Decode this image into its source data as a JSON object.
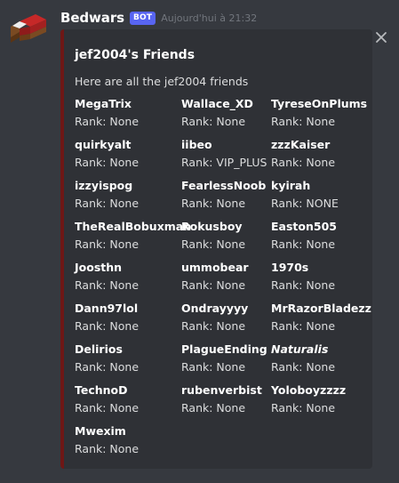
{
  "message": {
    "author": "Bedwars",
    "badge": "BOT",
    "timestamp": "Aujourd'hui à 21:32"
  },
  "colors": {
    "embed_border": "#6e1716",
    "badge_bg": "#5865f2",
    "background": "#36393f",
    "embed_bg": "#2f3136"
  },
  "icons": {
    "avatar": "bed-icon",
    "close": "close-icon"
  },
  "embed": {
    "title": "jef2004's Friends",
    "description": "Here are all the jef2004 friends",
    "fields": [
      {
        "name": "MegaTrix",
        "value": "Rank: None"
      },
      {
        "name": "Wallace_XD",
        "value": "Rank: None"
      },
      {
        "name": "TyreseOnPlums",
        "value": "Rank: None"
      },
      {
        "name": "quirkyalt",
        "value": "Rank: None"
      },
      {
        "name": "iibeo",
        "value": "Rank: VIP_PLUS"
      },
      {
        "name": "zzzKaiser",
        "value": "Rank: None"
      },
      {
        "name": "izzyispog",
        "value": "Rank: None"
      },
      {
        "name": "FearlessNoob",
        "value": "Rank: None"
      },
      {
        "name": "kyirah",
        "value": "Rank: NONE"
      },
      {
        "name": "TheRealBobuxman",
        "value": "Rank: None"
      },
      {
        "name": "Rokusboy",
        "value": "Rank: None"
      },
      {
        "name": "Easton505",
        "value": "Rank: None"
      },
      {
        "name": "Joosthn",
        "value": "Rank: None"
      },
      {
        "name": "ummobear",
        "value": "Rank: None"
      },
      {
        "name": "1970s",
        "value": "Rank: None"
      },
      {
        "name": "Dann97lol",
        "value": "Rank: None"
      },
      {
        "name": "Ondrayyyy",
        "value": "Rank: None"
      },
      {
        "name": "MrRazorBladezz",
        "value": "Rank: None"
      },
      {
        "name": "Delirios",
        "value": "Rank: None"
      },
      {
        "name": "PlagueEnding",
        "value": "Rank: None"
      },
      {
        "name": "Naturalis",
        "value": "Rank: None",
        "italic": true
      },
      {
        "name": "TechnoD",
        "value": "Rank: None"
      },
      {
        "name": "rubenverbist",
        "value": "Rank: None"
      },
      {
        "name": "Yoloboyzzzz",
        "value": "Rank: None"
      },
      {
        "name": "Mwexim",
        "value": "Rank: None"
      }
    ]
  }
}
